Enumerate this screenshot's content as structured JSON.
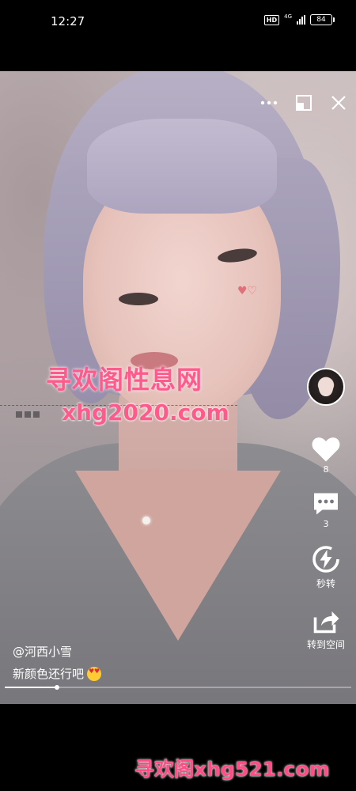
{
  "status_bar": {
    "time": "12:27",
    "hd": "HD",
    "network": "4G",
    "battery": "84"
  },
  "controls": {
    "more_icon": "more-dots-icon",
    "minimize_icon": "minimize-window-icon",
    "close_icon": "close-icon"
  },
  "watermark": {
    "title": "寻欢阁性息网",
    "domain": "xhg2020.com",
    "bottom": "寻欢阁xhg521.com"
  },
  "actions": {
    "like_count": "8",
    "comment_count": "3",
    "flash_label": "秒转",
    "share_label": "转到空间"
  },
  "post": {
    "author": "@河西小雪",
    "caption": "新颜色还行吧"
  },
  "playback": {
    "progress": 0.15
  },
  "colors": {
    "watermark": "#ff5a8c",
    "background": "#000000"
  }
}
